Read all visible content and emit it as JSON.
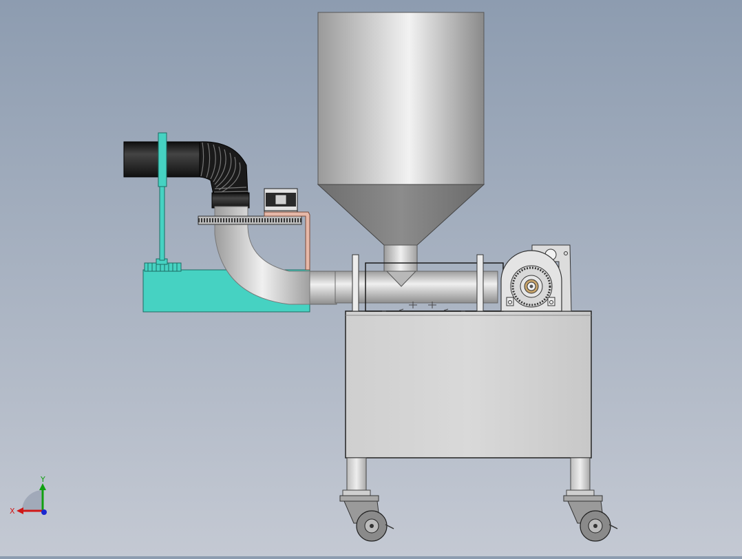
{
  "scene": {
    "background_top": "#8d9cb0",
    "background_bottom": "#c4c9d3",
    "colors": {
      "steel_light": "#e4e4e4",
      "steel_mid": "#b8b8b8",
      "steel_dark": "#7e7e7e",
      "cyan_part": "#46d2c2",
      "hose_black": "#1e1e1e",
      "copper_pipe": "#e6b8a8",
      "outline": "#2a2a2a"
    }
  },
  "triad": {
    "x_label": "X",
    "y_label": "Y",
    "x_color": "#d01818",
    "y_color": "#10a010",
    "z_color": "#1a28d0"
  }
}
